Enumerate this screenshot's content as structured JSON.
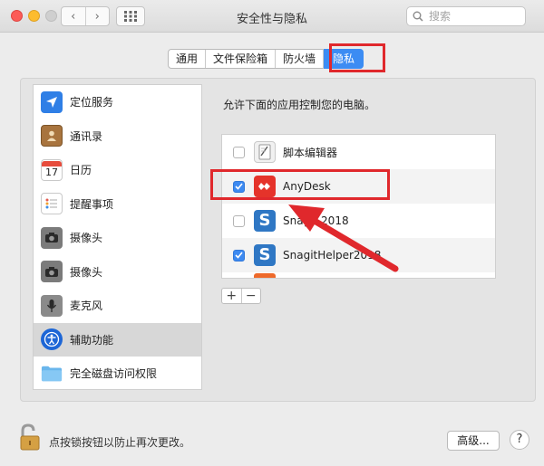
{
  "window": {
    "title": "安全性与隐私",
    "search_placeholder": "搜索"
  },
  "nav": {
    "back": "‹",
    "forward": "›"
  },
  "tabs": [
    {
      "label": "通用",
      "active": false
    },
    {
      "label": "文件保险箱",
      "active": false
    },
    {
      "label": "防火墙",
      "active": false
    },
    {
      "label": "隐私",
      "active": true
    }
  ],
  "sidebar": {
    "items": [
      {
        "label": "定位服务",
        "icon": "location-icon"
      },
      {
        "label": "通讯录",
        "icon": "contacts-icon"
      },
      {
        "label": "日历",
        "icon": "calendar-icon",
        "day": "17"
      },
      {
        "label": "提醒事项",
        "icon": "reminders-icon"
      },
      {
        "label": "摄像头",
        "icon": "camera-icon"
      },
      {
        "label": "摄像头",
        "icon": "camera-icon"
      },
      {
        "label": "麦克风",
        "icon": "microphone-icon"
      },
      {
        "label": "辅助功能",
        "icon": "accessibility-icon",
        "selected": true
      },
      {
        "label": "完全磁盘访问权限",
        "icon": "folder-icon"
      }
    ]
  },
  "main": {
    "label": "允许下面的应用控制您的电脑。",
    "apps": [
      {
        "name": "脚本编辑器",
        "checked": false,
        "icon": "script-editor-icon"
      },
      {
        "name": "AnyDesk",
        "checked": true,
        "icon": "anydesk-icon"
      },
      {
        "name": "Snagit 2018",
        "checked": false,
        "icon": "snagit-icon"
      },
      {
        "name": "SnagitHelper2018",
        "checked": true,
        "icon": "snagit-icon"
      }
    ],
    "add": "+",
    "remove": "−"
  },
  "footer": {
    "lock_text": "点按锁按钮以防止再次更改。",
    "advanced": "高级...",
    "help": "?"
  },
  "colors": {
    "accent": "#3c8cf3",
    "highlight": "#e0282c",
    "anydesk": "#e5332a"
  }
}
